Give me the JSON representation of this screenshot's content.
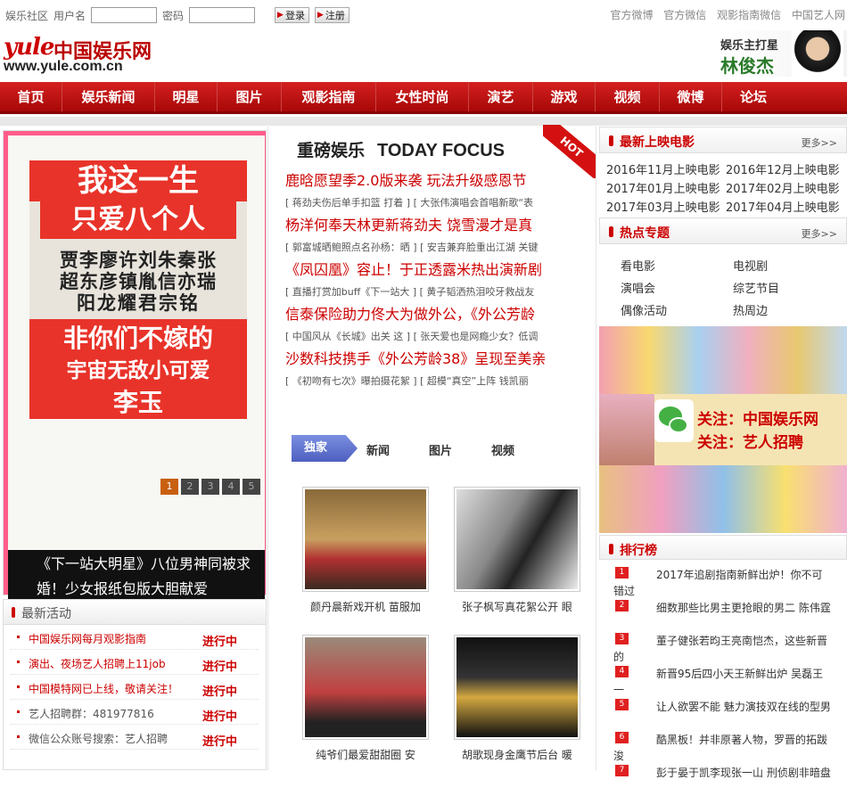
{
  "topbar": {
    "community": "娱乐社区",
    "username_label": "用户名",
    "password_label": "密码",
    "login": "登录",
    "register": "注册",
    "links": [
      "官方微博",
      "官方微信",
      "观影指南微信",
      "中国艺人网"
    ]
  },
  "logo": {
    "brand": "yule",
    "name": "中国娱乐网",
    "url": "www.yule.com.cn"
  },
  "banner": {
    "line1": "娱乐主打星",
    "line2": "林俊杰"
  },
  "nav": [
    "首页",
    "娱乐新闻",
    "明星",
    "图片",
    "观影指南",
    "女性时尚",
    "演艺",
    "游戏",
    "视频",
    "微博",
    "论坛"
  ],
  "slider": {
    "poster_title1": "我这一生",
    "poster_title2": "只爱八个人",
    "poster_names": [
      "贾李廖许刘朱秦张",
      "超东彦镇胤信亦瑞",
      "阳龙耀君宗铭"
    ],
    "poster_mid1": "非你们不嫁的",
    "poster_mid2": "宇宙无敌小可爱",
    "poster_sign": "李玉",
    "caption": "《下一站大明星》八位男神同被求婚！少女报纸包版大胆献爱",
    "pages": [
      "1",
      "2",
      "3",
      "4",
      "5"
    ]
  },
  "activity": {
    "title": "最新活动",
    "items": [
      {
        "text": "中国娱乐网每月观影指南",
        "status": "进行中",
        "red": true
      },
      {
        "text": "演出、夜场艺人招聘上11job",
        "status": "进行中",
        "red": true
      },
      {
        "text": "中国模特网已上线，敬请关注！",
        "status": "进行中",
        "red": true
      },
      {
        "text": "艺人招聘群：481977816",
        "status": "进行中",
        "red": false
      },
      {
        "text": "微信公众账号搜索：艺人招聘",
        "status": "进行中",
        "red": false
      }
    ]
  },
  "focus": {
    "title_cn": "重磅娱乐",
    "title_en": "TODAY FOCUS",
    "hot": "HOT",
    "news": [
      {
        "headline": "鹿晗愿望季2.0版来袭 玩法升级感恩节",
        "sub": "[ 蒋劲夫伤后单手扣篮 打着 ] [ 大张伟演唱会首唱新歌“表"
      },
      {
        "headline": "杨洋何奉天林更新蒋劲夫 饶雪漫才是真",
        "sub": "[ 郭富城晒鲍照点名孙杨：晒 ] [ 安吉兼弃脸重出江湖 关键"
      },
      {
        "headline": "《凤囚凰》容止！于正透露米热出演新剧",
        "sub": "[ 直播打赏加buff《下一站大 ] [ 黄子韬洒热泪咬牙救战友"
      },
      {
        "headline": "信泰保险助力佟大为做外公，《外公芳龄",
        "sub": "[ 中国风从《长城》出关 这 ] [ 张天爱也是网瘾少女？低调"
      },
      {
        "headline": "沙数科技携手《外公芳龄38》呈现至美亲",
        "sub": "[ 《初吻有七次》曝拍摄花絮 ] [ 超模“真空”上阵 钱凯丽"
      }
    ],
    "tabs": [
      "独家",
      "新闻",
      "图片",
      "视频"
    ],
    "photos": [
      "颜丹晨新戏开机 苗服加",
      "张子枫写真花絮公开 眼",
      "纯爷们最爱甜甜圈 安",
      "胡歌现身金鹰节后台 暖"
    ]
  },
  "movies": {
    "title": "最新上映电影",
    "more": "更多>>",
    "items": [
      "2016年11月上映电影",
      "2016年12月上映电影",
      "2017年01月上映电影",
      "2017年02月上映电影",
      "2017年03月上映电影",
      "2017年04月上映电影"
    ]
  },
  "topics": {
    "title": "热点专题",
    "more": "更多>>",
    "items": [
      "看电影",
      "电视剧",
      "演唱会",
      "综艺节目",
      "偶像活动",
      "热周边"
    ]
  },
  "promo": {
    "line1": "关注：中国娱乐网",
    "line2": "关注：艺人招聘"
  },
  "ranking": {
    "title": "排行榜",
    "items": [
      "2017年追剧指南新鲜出炉！你不可错过",
      "细数那些比男主更抢眼的男二 陈伟霆",
      "董子健张若昀王亮南恺杰，这些新晋的",
      "新晋95后四小天王新鲜出炉 吴磊王一",
      "让人欲罢不能 魅力演技双在线的型男",
      "酷黑板！并非原著人物，罗晋的拓跋浚",
      "彭于晏于凯李现张一山 刑侦剧非暗盘"
    ]
  },
  "colors": {
    "brand_red": "#c00",
    "nav_red": "#c41414",
    "pink": "#ff5c8a"
  }
}
